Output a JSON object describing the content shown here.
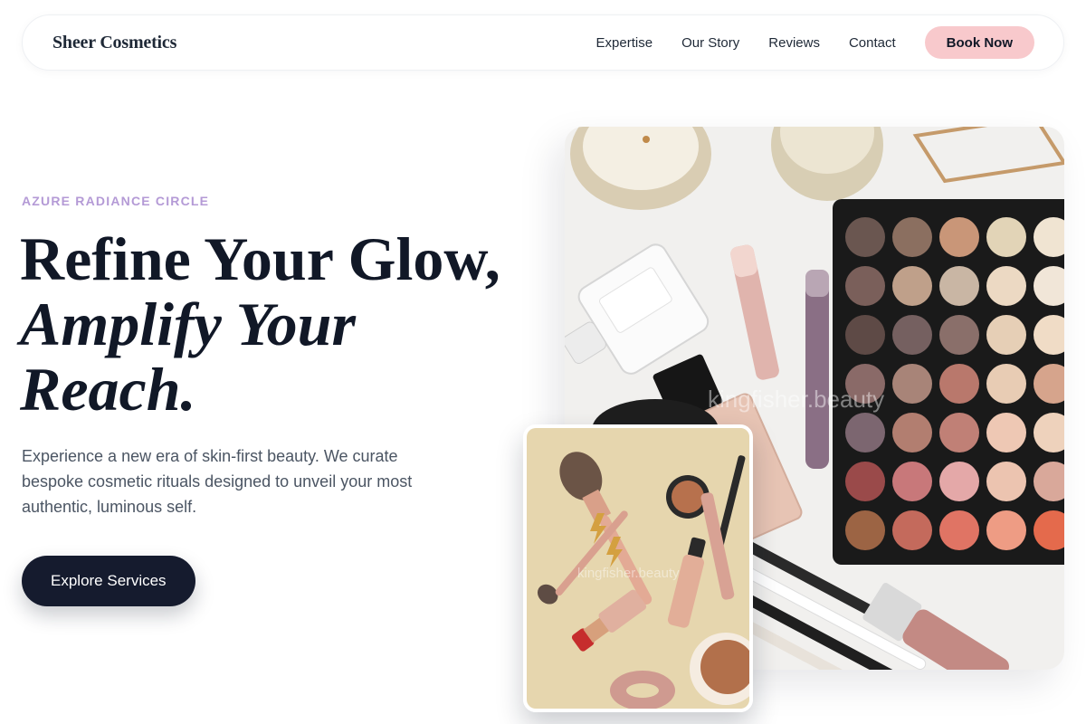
{
  "brand": {
    "name": "Sheer Cosmetics"
  },
  "nav": {
    "links": [
      "Expertise",
      "Our Story",
      "Reviews",
      "Contact"
    ],
    "cta_label": "Book Now"
  },
  "hero": {
    "eyebrow": "AZURE RADIANCE CIRCLE",
    "headline_line1": "Refine Your Glow,",
    "headline_line2": "Amplify Your Reach.",
    "lead": "Experience a new era of skin-first beauty. We curate bespoke cosmetic rituals designed to unveil your most authentic, luminous self.",
    "cta_label": "Explore Services"
  },
  "images": {
    "main_watermark": "kingfisher.beauty",
    "small_watermark": "kingfisher.beauty",
    "main_alt": "flat lay of eyeshadow palette, candles, perfume and makeup",
    "small_alt": "makeup brushes, lipstick and powder on beige background"
  },
  "colors": {
    "accent_pink": "#f8c9cc",
    "eyebrow_lavender": "#b49ad6",
    "cta_navy": "#151b2e",
    "text_dark": "#111827"
  }
}
